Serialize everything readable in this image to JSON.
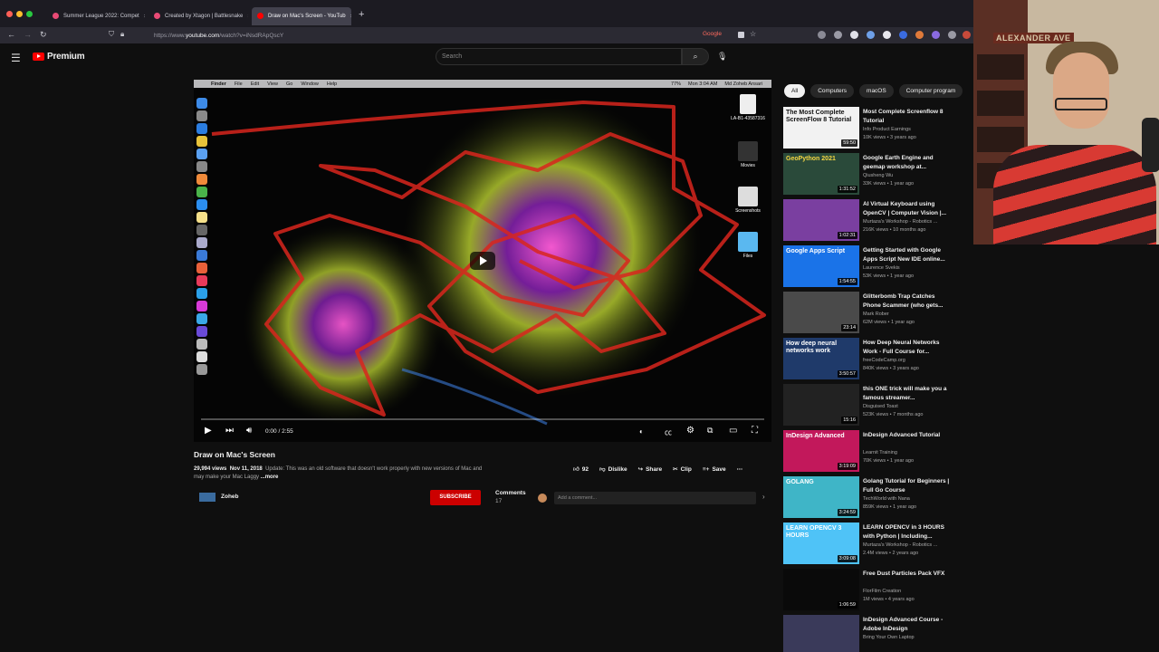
{
  "browser": {
    "tabs": [
      {
        "label": "Summer League 2022: Compet",
        "favicon_color": "#e84a75",
        "active": false
      },
      {
        "label": "Created by Xtagon | Battlesnake",
        "favicon_color": "#e84a75",
        "active": false
      },
      {
        "label": "Draw on Mac's Screen - YouTub",
        "favicon_color": "#ff0000",
        "active": true
      }
    ],
    "tab_close": "×",
    "new_tab": "+",
    "url_prefix": "https://www.",
    "url_host": "youtube.com",
    "url_path": "/watch?v=iNsdRApQscY",
    "google_badge": "Google"
  },
  "youtube": {
    "logo_text": "Premium",
    "search_placeholder": "Search",
    "search_icon": "magnifier-icon",
    "mic_icon": "microphone-icon"
  },
  "video": {
    "mac_menu": [
      "Finder",
      "File",
      "Edit",
      "View",
      "Go",
      "Window",
      "Help"
    ],
    "mac_status_battery": "77%",
    "mac_status_time": "Mon 3:04 AM",
    "mac_status_user": "Md Zoheb Ansari",
    "desktop_icons": [
      "LA-B1-43587316",
      "Movies",
      "Screenshots",
      "Files"
    ],
    "time_current": "0:00",
    "time_total": "2:55",
    "time_sep": " / ",
    "progress": 0.0
  },
  "details": {
    "title": "Draw on Mac's Screen",
    "views": "29,994 views",
    "date": "Nov 11, 2018",
    "description": "Update: This was an old software that doesn't work properly with new versions of Mac and may make your Mac Laggy",
    "more": "...more",
    "likes": "92",
    "dislike": "Dislike",
    "share": "Share",
    "clip": "Clip",
    "save": "Save",
    "channel": "Zoheb",
    "subscribe": "SUBSCRIBE",
    "comments_label": "Comments",
    "comments_count": "17",
    "comment_placeholder": "Add a comment..."
  },
  "sidebar": {
    "chips": [
      "All",
      "Computers",
      "macOS",
      "Computer program"
    ],
    "items": [
      {
        "title": "Most Complete Screenflow 8 Tutorial",
        "channel": "Info Product Earnings",
        "views": "10K views • 3 years ago",
        "duration": "59:50",
        "thumb_text": "The Most Complete ScreenFlow 8 Tutorial",
        "thumb_color": "#f2f2f2",
        "thumb_text_color": "#111111"
      },
      {
        "title": "Google Earth Engine and geemap workshop at...",
        "channel": "Qiusheng Wu",
        "views": "33K views • 1 year ago",
        "duration": "1:31:52",
        "thumb_text": "GeoPython 2021",
        "thumb_color": "#2a4a3a",
        "thumb_text_color": "#f5d742"
      },
      {
        "title": "AI Virtual Keyboard using OpenCV | Computer Vision |...",
        "channel": "Murtaza's Workshop - Robotics ...",
        "views": "216K views • 10 months ago",
        "duration": "1:02:31",
        "thumb_text": "",
        "thumb_color": "#7a3fa0",
        "thumb_text_color": "#ffffff"
      },
      {
        "title": "Getting Started with Google Apps Script New IDE online...",
        "channel": "Laurence Svekis",
        "views": "53K views • 1 year ago",
        "duration": "1:54:55",
        "thumb_text": "Google Apps Script",
        "thumb_color": "#1a73e8",
        "thumb_text_color": "#ffffff"
      },
      {
        "title": "Glitterbomb Trap Catches Phone Scammer (who gets...",
        "channel": "Mark Rober",
        "views": "62M views • 1 year ago",
        "duration": "23:14",
        "thumb_text": "",
        "thumb_color": "#4a4a4a",
        "thumb_text_color": "#ffffff"
      },
      {
        "title": "How Deep Neural Networks Work - Full Course for...",
        "channel": "freeCodeCamp.org",
        "views": "840K views • 3 years ago",
        "duration": "3:50:57",
        "thumb_text": "How deep neural networks work",
        "thumb_color": "#1f3a6a",
        "thumb_text_color": "#ffffff"
      },
      {
        "title": "this ONE trick will make you a famous streamer...",
        "channel": "Disguised Toast",
        "views": "523K views • 7 months ago",
        "duration": "15:16",
        "thumb_text": "",
        "thumb_color": "#222222",
        "thumb_text_color": "#ff3b3b"
      },
      {
        "title": "InDesign Advanced Tutorial",
        "channel": "Learnit Training",
        "views": "70K views • 1 year ago",
        "duration": "3:19:09",
        "thumb_text": "InDesign Advanced",
        "thumb_color": "#c2185b",
        "thumb_text_color": "#ffffff"
      },
      {
        "title": "Golang Tutorial for Beginners | Full Go Course",
        "channel": "TechWorld with Nana",
        "views": "859K views • 1 year ago",
        "duration": "3:24:59",
        "thumb_text": "GOLANG",
        "thumb_color": "#3fb5c7",
        "thumb_text_color": "#ffffff"
      },
      {
        "title": "LEARN OPENCV in 3 HOURS with Python | Including...",
        "channel": "Murtaza's Workshop - Robotics ...",
        "views": "2.4M views • 2 years ago",
        "duration": "3:09:08",
        "thumb_text": "LEARN OPENCV 3 HOURS",
        "thumb_color": "#4fc3f7",
        "thumb_text_color": "#ffffff"
      },
      {
        "title": "Free Dust Particles Pack VFX",
        "channel": "FlorFilm Creation",
        "views": "1M views • 4 years ago",
        "duration": "1:06:59",
        "thumb_text": "",
        "thumb_color": "#0a0a0a",
        "thumb_text_color": "#ffffff"
      },
      {
        "title": "InDesign Advanced Course - Adobe InDesign",
        "channel": "Bring Your Own Laptop",
        "views": "",
        "duration": "",
        "thumb_text": "",
        "thumb_color": "#3a3a5a",
        "thumb_text_color": "#ffffff"
      }
    ]
  },
  "webcam": {
    "sign_text": "ALEXANDER AVE"
  },
  "colors": {
    "background": "#0f0f0f",
    "accent": "#ff0000",
    "subscribe": "#cc0000",
    "annotation_red": "#d8261d"
  }
}
